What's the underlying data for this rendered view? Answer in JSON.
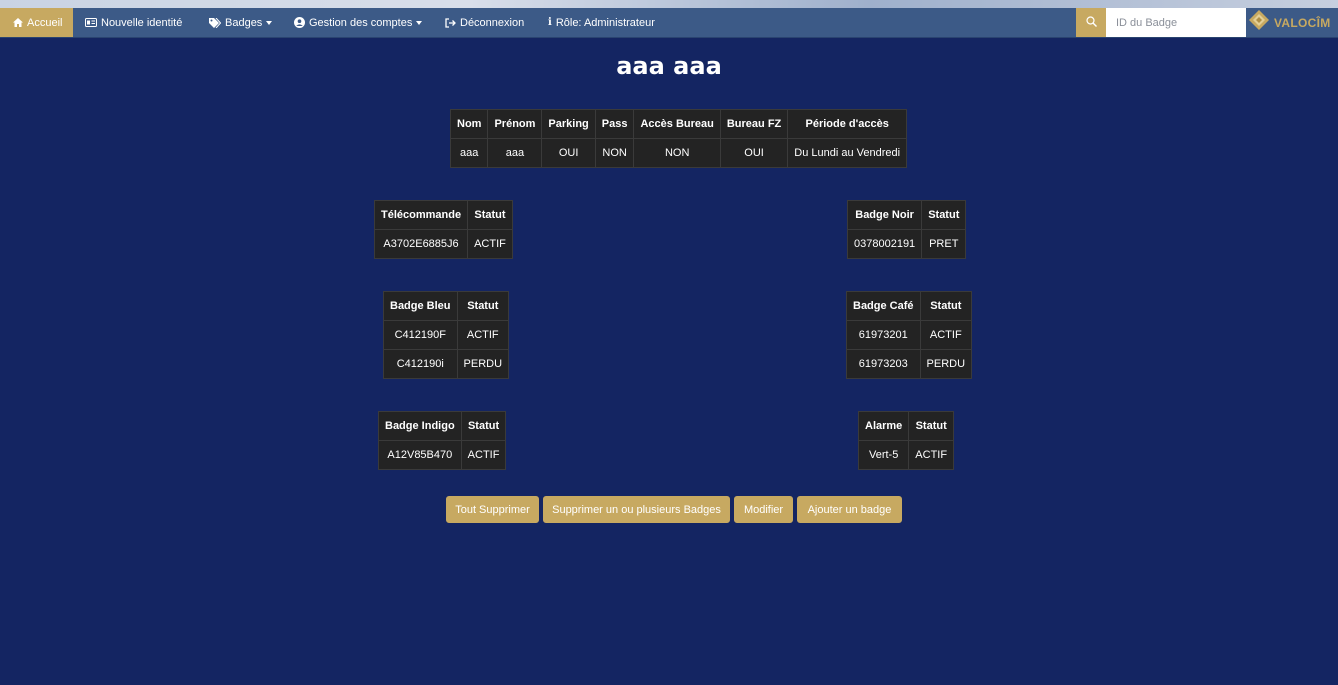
{
  "nav": {
    "home_label": "Accueil",
    "new_identity_label": "Nouvelle identité",
    "badges_label": "Badges",
    "accounts_label": "Gestion des comptes",
    "logout_label": "Déconnexion",
    "role_label": "Rôle: Administrateur",
    "search_placeholder": "ID du Badge",
    "logo_text": "VALOCÎM"
  },
  "page": {
    "title": "aaa aaa"
  },
  "identity": {
    "headers": [
      "Nom",
      "Prénom",
      "Parking",
      "Pass",
      "Accès Bureau",
      "Bureau FZ",
      "Période d'accès"
    ],
    "row": [
      "aaa",
      "aaa",
      "OUI",
      "NON",
      "NON",
      "OUI",
      "Du Lundi au Vendredi"
    ]
  },
  "telecommande": {
    "headers": [
      "Télécommande",
      "Statut"
    ],
    "rows": [
      [
        "A3702E6885J6",
        "ACTIF"
      ]
    ]
  },
  "badge_noir": {
    "headers": [
      "Badge Noir",
      "Statut"
    ],
    "rows": [
      [
        "0378002191",
        "PRET"
      ]
    ]
  },
  "badge_bleu": {
    "headers": [
      "Badge Bleu",
      "Statut"
    ],
    "rows": [
      [
        "C412190F",
        "ACTIF"
      ],
      [
        "C412190i",
        "PERDU"
      ]
    ]
  },
  "badge_cafe": {
    "headers": [
      "Badge Café",
      "Statut"
    ],
    "rows": [
      [
        "61973201",
        "ACTIF"
      ],
      [
        "61973203",
        "PERDU"
      ]
    ]
  },
  "badge_indigo": {
    "headers": [
      "Badge Indigo",
      "Statut"
    ],
    "rows": [
      [
        "A12V85B470",
        "ACTIF"
      ]
    ]
  },
  "alarme": {
    "headers": [
      "Alarme",
      "Statut"
    ],
    "rows": [
      [
        "Vert-5",
        "ACTIF"
      ]
    ]
  },
  "actions": {
    "delete_all": "Tout Supprimer",
    "delete_some": "Supprimer un ou plusieurs Badges",
    "modify": "Modifier",
    "add_badge": "Ajouter un badge"
  },
  "colors": {
    "background": "#142562",
    "navbar": "#3c5a87",
    "accent_gold": "#c7a961",
    "table_cell": "#232323"
  }
}
